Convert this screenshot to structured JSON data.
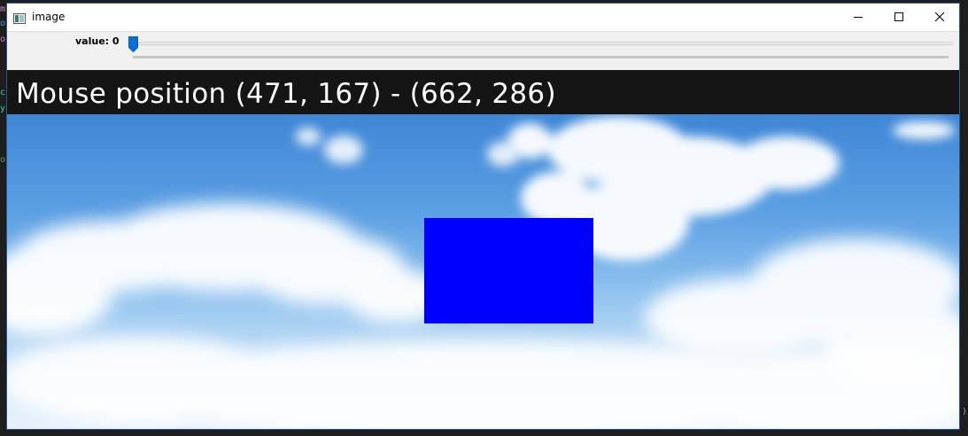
{
  "window": {
    "title": "image",
    "icons": {
      "app": "image-window-icon",
      "minimize": "minimize-icon",
      "maximize": "maximize-icon",
      "close": "close-icon"
    }
  },
  "toolbar": {
    "slider_label": "value: 0",
    "slider_value": 0
  },
  "image": {
    "mouse_text": "Mouse position (471, 167) - (662, 286)",
    "rectangle_color": "#0000ff",
    "header_color": "#151515"
  }
}
